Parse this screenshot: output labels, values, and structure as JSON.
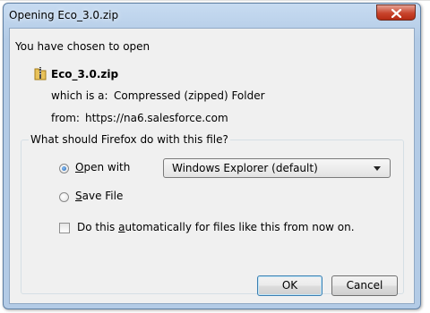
{
  "window": {
    "title": "Opening Eco_3.0.zip"
  },
  "intro": {
    "text": "You have chosen to open"
  },
  "file": {
    "name": "Eco_3.0.zip",
    "type_label": "which is a:",
    "type_value": "Compressed (zipped) Folder",
    "from_label": "from:",
    "from_value": "https://na6.salesforce.com",
    "icon": "zip-folder-icon"
  },
  "group": {
    "legend": "What should Firefox do with this file?"
  },
  "options": {
    "open_with": {
      "prefix": "",
      "mnemonic": "O",
      "rest": "pen with",
      "checked": true
    },
    "app_select": {
      "value": "Windows Explorer (default)"
    },
    "save_file": {
      "mnemonic": "S",
      "rest": "ave File",
      "checked": false
    },
    "auto": {
      "before": "Do this ",
      "mnemonic": "a",
      "after": "utomatically for files like this from now on.",
      "checked": false
    }
  },
  "buttons": {
    "ok": "OK",
    "cancel": "Cancel"
  },
  "colors": {
    "titlebar": "#b9d1ea",
    "close_button": "#c8442c",
    "dialog_bg": "#f0f0f0",
    "default_button_border": "#3c7fb1"
  }
}
